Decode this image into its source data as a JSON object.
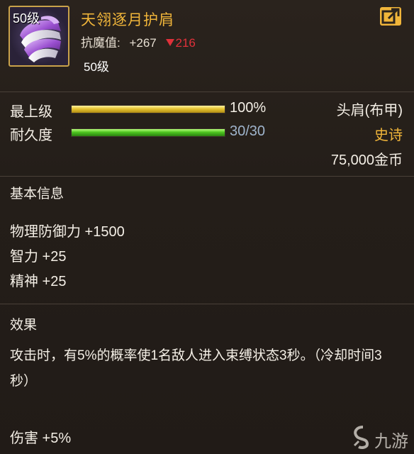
{
  "item": {
    "icon": "purple-shoulder-armor-icon",
    "level_badge": "50级",
    "name": "天翎逐月护肩",
    "stat_label": "抗魔值:",
    "stat_plus": "+267",
    "stat_minus": "216",
    "level_text": "50级"
  },
  "bars": {
    "top_level": {
      "label": "最上级",
      "value_text": "100%",
      "fill": 1.0
    },
    "durability": {
      "label": "耐久度",
      "value_text": "30/30",
      "fill": 1.0
    }
  },
  "info": {
    "slot": "头肩(布甲)",
    "quality": "史诗",
    "price": "75,000金币"
  },
  "basic": {
    "title": "基本信息",
    "attrs": [
      "物理防御力 +1500",
      "智力 +25",
      "精神 +25"
    ]
  },
  "effect": {
    "title": "效果",
    "text": "攻击时，有5%的概率使1名敌人进入束缚状态3秒。（冷却时间3秒）",
    "damage": "伤害 +5%"
  },
  "colors": {
    "name": "#f0b53a",
    "quality": "#f0b53a",
    "minus": "#e0313a",
    "durability_value": "#9fb4cc"
  },
  "watermark": {
    "text": "九游"
  }
}
